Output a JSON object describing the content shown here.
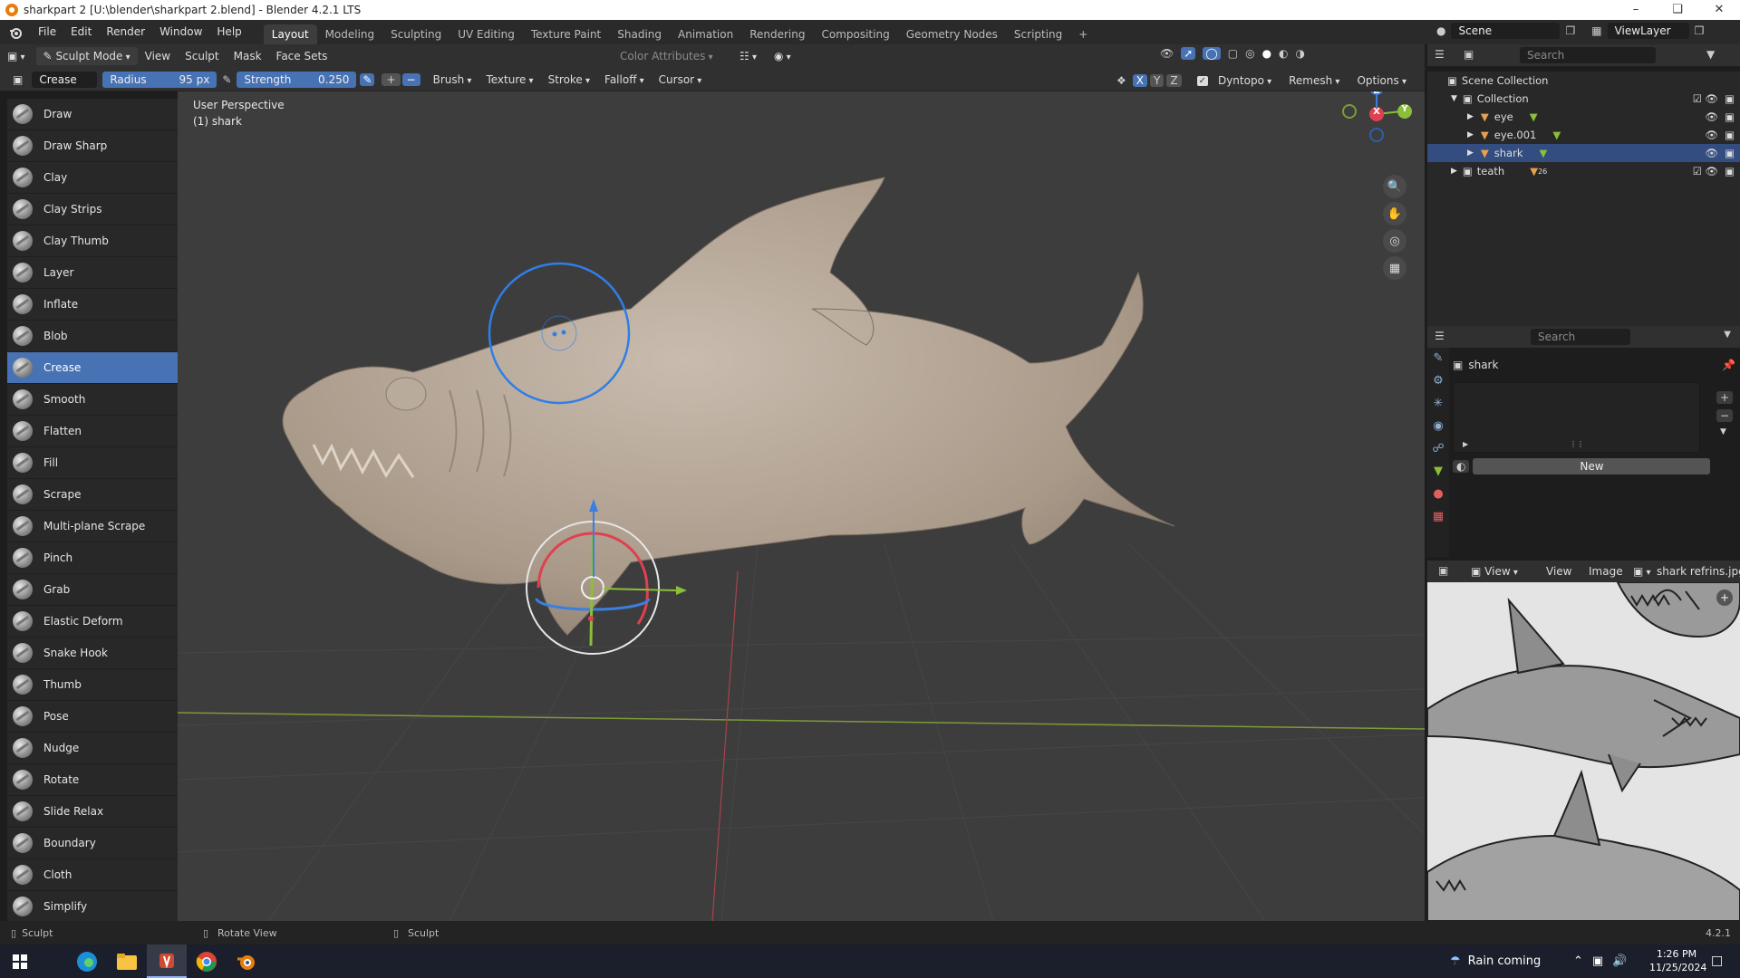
{
  "window": {
    "title": "sharkpart 2 [U:\\blender\\sharkpart 2.blend] - Blender 4.2.1 LTS",
    "controls": [
      "–",
      "❏",
      "✕"
    ]
  },
  "menubar": {
    "menus": [
      "File",
      "Edit",
      "Render",
      "Window",
      "Help"
    ],
    "workspaces": [
      "Layout",
      "Modeling",
      "Sculpting",
      "UV Editing",
      "Texture Paint",
      "Shading",
      "Animation",
      "Rendering",
      "Compositing",
      "Geometry Nodes",
      "Scripting"
    ],
    "active_workspace": "Layout",
    "add_tab": "+",
    "scene_label": "Scene",
    "viewlayer_label": "ViewLayer"
  },
  "viewport_header": {
    "mode": "Sculpt Mode",
    "menus": [
      "View",
      "Sculpt",
      "Mask",
      "Face Sets"
    ],
    "color_attributes": "Color Attributes"
  },
  "tool_header": {
    "tool_name": "Crease",
    "radius_label": "Radius",
    "radius_value": "95 px",
    "strength_label": "Strength",
    "strength_value": "0.250",
    "plus": "+",
    "minus": "−",
    "dropdowns": [
      "Brush",
      "Texture",
      "Stroke",
      "Falloff",
      "Cursor"
    ],
    "axes": [
      "X",
      "Y",
      "Z"
    ],
    "dyntopo": "Dyntopo",
    "remesh": "Remesh",
    "options": "Options"
  },
  "toolbar": {
    "tools": [
      "Draw",
      "Draw Sharp",
      "Clay",
      "Clay Strips",
      "Clay Thumb",
      "Layer",
      "Inflate",
      "Blob",
      "Crease",
      "Smooth",
      "Flatten",
      "Fill",
      "Scrape",
      "Multi-plane Scrape",
      "Pinch",
      "Grab",
      "Elastic Deform",
      "Snake Hook",
      "Thumb",
      "Pose",
      "Nudge",
      "Rotate",
      "Slide Relax",
      "Boundary",
      "Cloth",
      "Simplify"
    ],
    "active_tool": "Crease"
  },
  "viewport": {
    "perspective": "User Perspective",
    "object": "(1) shark",
    "gizmo_axes": {
      "z": "Z",
      "x": "X",
      "y": "Y"
    }
  },
  "outliner": {
    "search_placeholder": "Search",
    "scene_collection": "Scene Collection",
    "collection": "Collection",
    "items": [
      {
        "name": "eye",
        "selected": false
      },
      {
        "name": "eye.001",
        "selected": false
      },
      {
        "name": "shark",
        "selected": true
      }
    ],
    "teath": "teath",
    "teath_count": "26"
  },
  "properties": {
    "search_placeholder": "Search",
    "object_name": "shark",
    "new_button": "New",
    "plus": "+",
    "minus": "−"
  },
  "image_editor": {
    "view_dropdown": "View",
    "menus": [
      "View",
      "Image"
    ],
    "image_name": "shark refrins.jpg"
  },
  "statusbar": {
    "left": "Sculpt",
    "middle": "Rotate View",
    "right": "Sculpt",
    "version": "4.2.1"
  },
  "taskbar": {
    "weather": "Rain coming",
    "time": "1:26 PM",
    "date": "11/25/2024"
  },
  "colors": {
    "accent": "#4772b3",
    "x_axis": "#e0404f",
    "y_axis": "#8bbf3a",
    "z_axis": "#3a7fe0",
    "shark": "#b7a898"
  }
}
